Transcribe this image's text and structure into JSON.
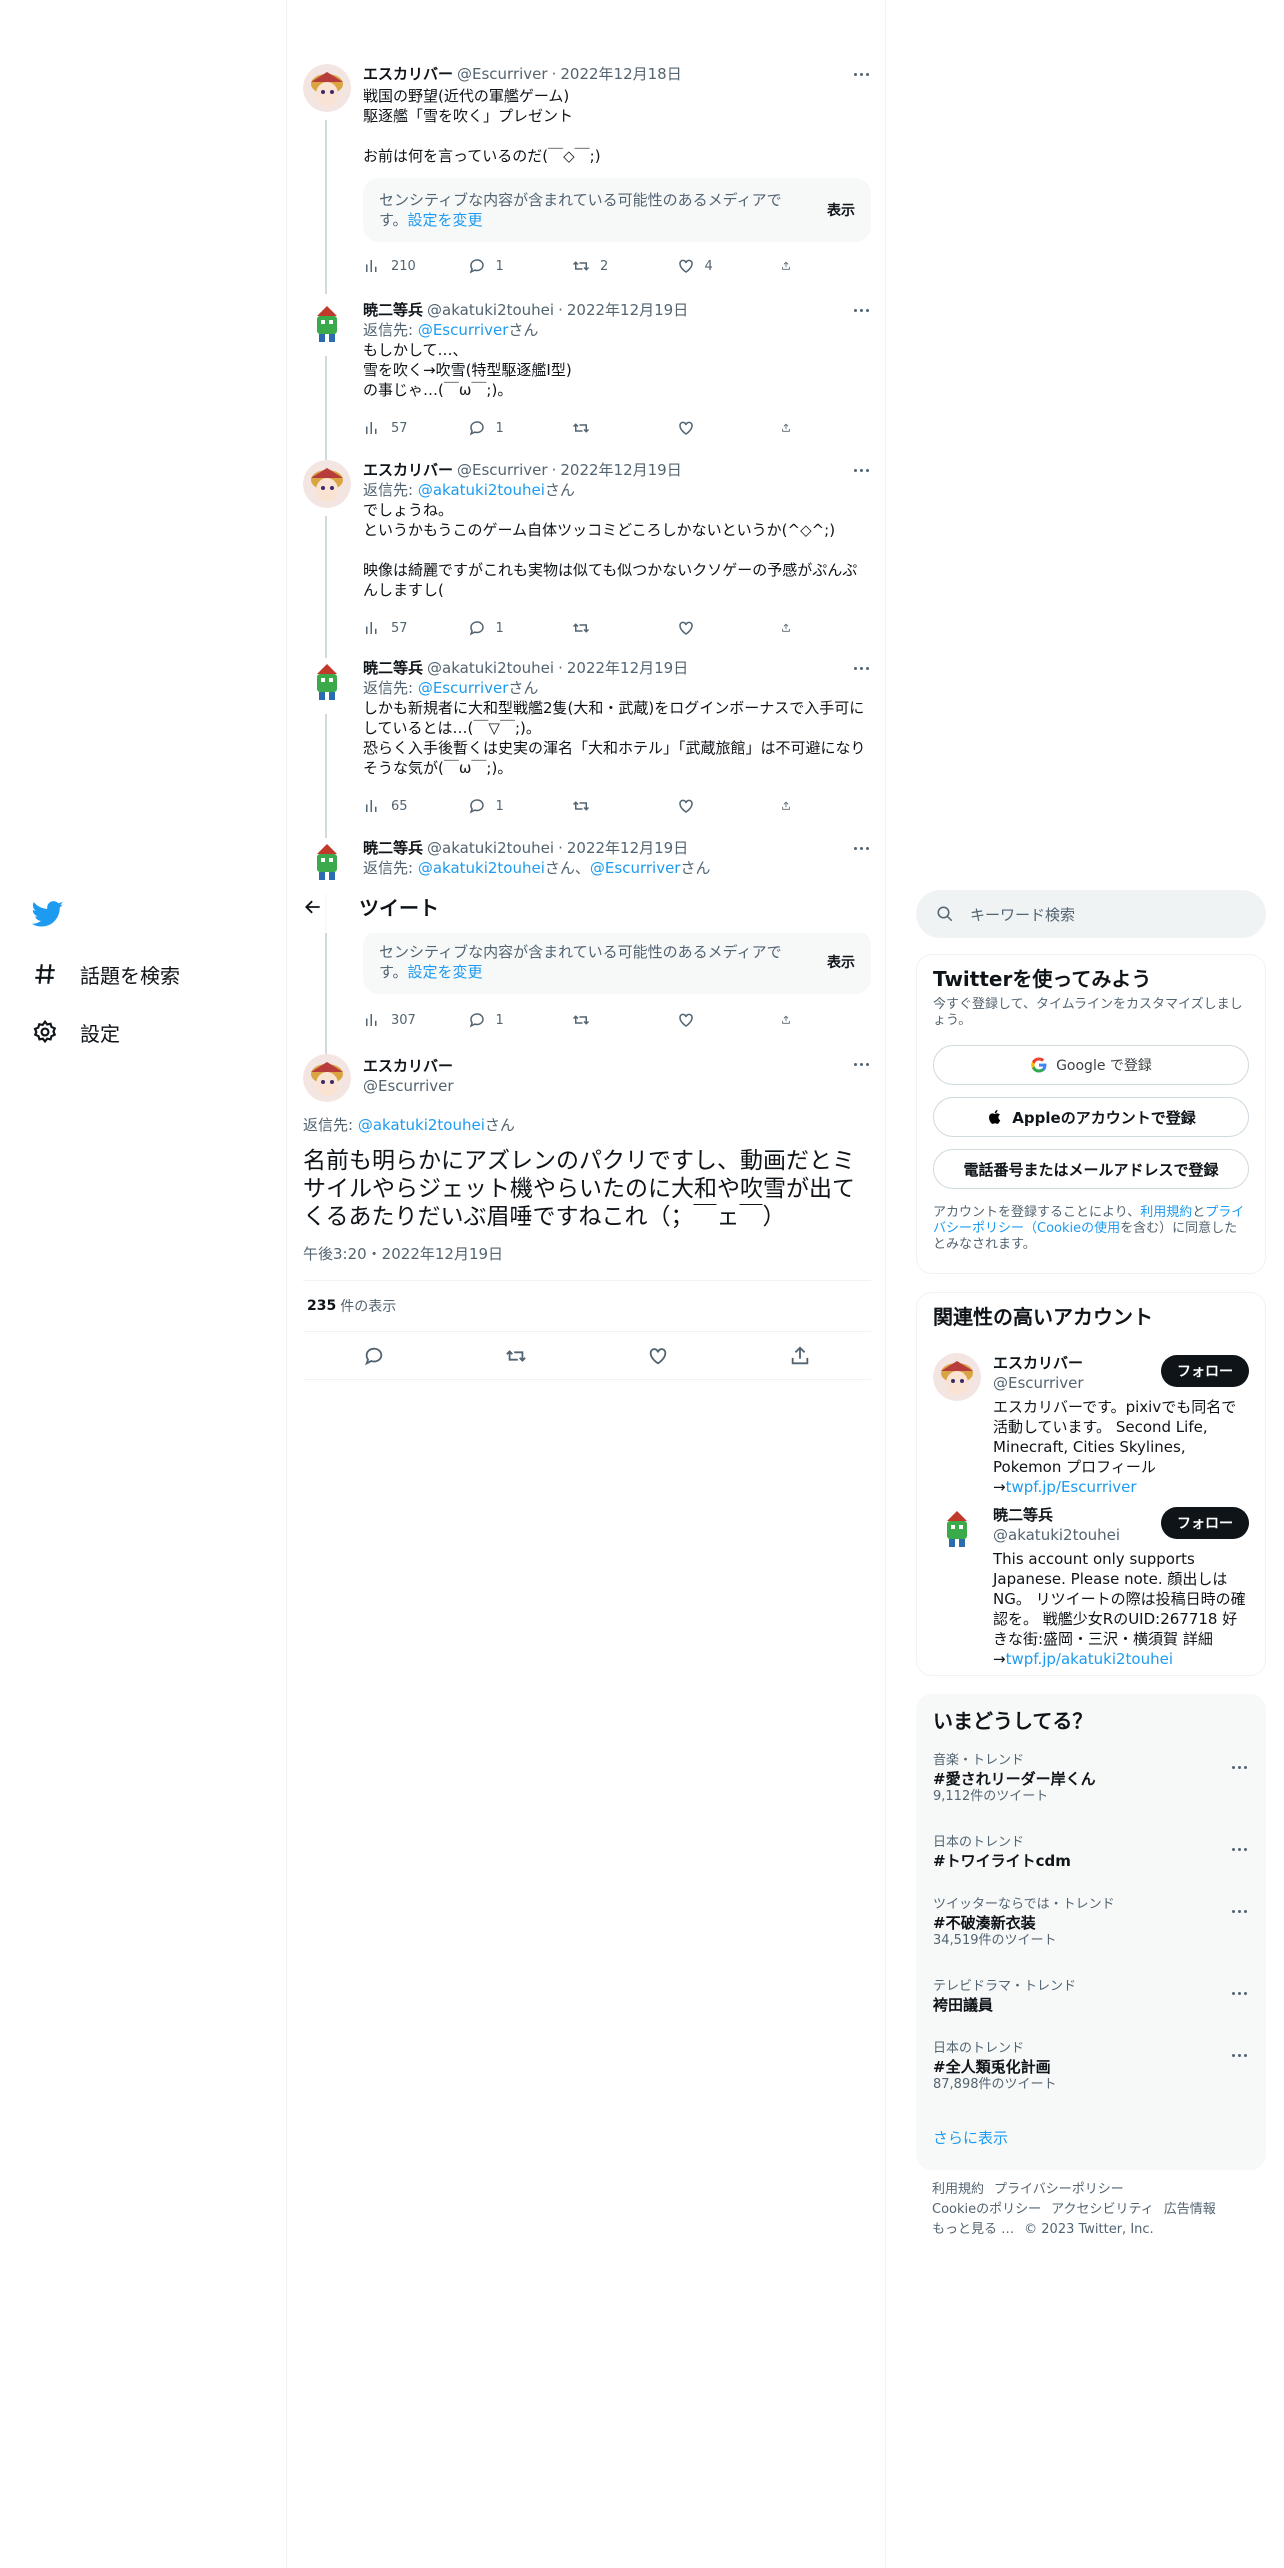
{
  "nav": {
    "items": [
      {
        "label": "話題を検索",
        "icon": "hashtag-icon"
      },
      {
        "label": "設定",
        "icon": "gear-icon"
      }
    ]
  },
  "header": {
    "title": "ツイート"
  },
  "thread": [
    {
      "name": "エスカリバー",
      "handle": "@Escurriver",
      "date": "2022年12月18日",
      "text": "戦国の野望(近代の軍艦ゲーム)\n駆逐艦「雪を吹く」プレゼント\n\nお前は何を言っているのだ(￣◇￣;)",
      "sensitive": {
        "text": "センシティブな内容が含まれている可能性のあるメディアです。",
        "link": "設定を変更",
        "button": "表示"
      },
      "stats": {
        "views": "210",
        "replies": "1",
        "retweets": "2",
        "likes": "4"
      }
    },
    {
      "name": "暁二等兵",
      "handle": "@akatuki2touhei",
      "date": "2022年12月19日",
      "reply_prefix": "返信先: ",
      "reply_mention": "@Escurriver",
      "reply_suffix": "さん",
      "text": "もしかして…、\n雪を吹く→吹雪(特型駆逐艦Ⅰ型)\nの事じゃ…(￣ω￣;)。",
      "stats": {
        "views": "57",
        "replies": "1",
        "retweets": "",
        "likes": ""
      }
    },
    {
      "name": "エスカリバー",
      "handle": "@Escurriver",
      "date": "2022年12月19日",
      "reply_prefix": "返信先: ",
      "reply_mention": "@akatuki2touhei",
      "reply_suffix": "さん",
      "text": "でしょうね。\nというかもうこのゲーム自体ツッコミどころしかないというか(^◇^;)\n\n映像は綺麗ですがこれも実物は似ても似つかないクソゲーの予感がぷんぷんしますし(",
      "stats": {
        "views": "57",
        "replies": "1",
        "retweets": "",
        "likes": ""
      }
    },
    {
      "name": "暁二等兵",
      "handle": "@akatuki2touhei",
      "date": "2022年12月19日",
      "reply_prefix": "返信先: ",
      "reply_mention": "@Escurriver",
      "reply_suffix": "さん",
      "text": "しかも新規者に大和型戦艦2隻(大和・武蔵)をログインボーナスで入手可にしているとは…(￣▽￣;)。\n恐らく入手後暫くは史実の渾名「大和ホテル」「武蔵旅館」は不可避になりそうな気が(￣ω￣;)。",
      "stats": {
        "views": "65",
        "replies": "1",
        "retweets": "",
        "likes": ""
      }
    },
    {
      "name": "暁二等兵",
      "handle": "@akatuki2touhei",
      "date": "2022年12月19日",
      "reply_prefix": "返信先: ",
      "reply_mention": "@akatuki2touhei",
      "reply_mid": "さん、",
      "reply_mention2": "@Escurriver",
      "reply_suffix": "さん",
      "sensitive": {
        "text": "センシティブな内容が含まれている可能性のあるメディアです。",
        "link": "設定を変更",
        "button": "表示"
      },
      "stats": {
        "views": "307",
        "replies": "1",
        "retweets": "",
        "likes": ""
      }
    }
  ],
  "main": {
    "name": "エスカリバー",
    "handle": "@Escurriver",
    "reply_prefix": "返信先: ",
    "reply_mention": "@akatuki2touhei",
    "reply_suffix": "さん",
    "text": "名前も明らかにアズレンのパクリですし、動画だとミサイルやらジェット機やらいたのに大和や吹雪が出てくるあたりだいぶ眉唾ですねこれ（；￣ェ￣）",
    "time": "午後3:20・2022年12月19日",
    "views_count": "235",
    "views_label": "件の表示"
  },
  "search": {
    "placeholder": "キーワード検索"
  },
  "signup": {
    "title": "Twitterを使ってみよう",
    "subtitle": "今すぐ登録して、タイムラインをカスタマイズしましょう。",
    "google": "Google で登録",
    "apple": "Appleのアカウントで登録",
    "phone": "電話番号またはメールアドレスで登録",
    "legal_1": "アカウントを登録することにより、",
    "legal_terms": "利用規約",
    "legal_2": "と",
    "legal_privacy": "プライバシーポリシー（Cookieの使用",
    "legal_3": "を含む）に同意したとみなされます。"
  },
  "related": {
    "title": "関連性の高いアカウント",
    "follow": "フォロー",
    "accounts": [
      {
        "name": "エスカリバー",
        "handle": "@Escurriver",
        "bio": "エスカリバーです。pixivでも同名で活動しています。 Second Life, Minecraft, Cities Skylines, Pokemon プロフィール→",
        "link": "twpf.jp/Escurriver"
      },
      {
        "name": "暁二等兵",
        "handle": "@akatuki2touhei",
        "bio": "This account only supports Japanese. Please note. 顔出しはNG。 リツイートの際は投稿日時の確認を。 戦艦少女RのUID:267718 好きな街:盛岡・三沢・横須賀 詳細→",
        "link": "twpf.jp/akatuki2touhei"
      }
    ]
  },
  "trends": {
    "title": "いまどうしてる？",
    "items": [
      {
        "context": "音楽・トレンド",
        "name": "#愛されリーダー岸くん",
        "count": "9,112件のツイート"
      },
      {
        "context": "日本のトレンド",
        "name": "#トワイライトcdm",
        "count": ""
      },
      {
        "context": "ツイッターならでは・トレンド",
        "name": "#不破湊新衣装",
        "count": "34,519件のツイート"
      },
      {
        "context": "テレビドラマ・トレンド",
        "name": "袴田議員",
        "count": ""
      },
      {
        "context": "日本のトレンド",
        "name": "#全人類兎化計画",
        "count": "87,898件のツイート"
      }
    ],
    "show_more": "さらに表示"
  },
  "footer": {
    "links": [
      "利用規約",
      "プライバシーポリシー",
      "Cookieのポリシー",
      "アクセシビリティ",
      "広告情報",
      "もっと見る …"
    ],
    "copyright": "© 2023 Twitter, Inc."
  },
  "colors": {
    "accent": "#1d9bf0",
    "text": "#0f1419",
    "muted": "#536471",
    "border": "#eff3f4"
  }
}
